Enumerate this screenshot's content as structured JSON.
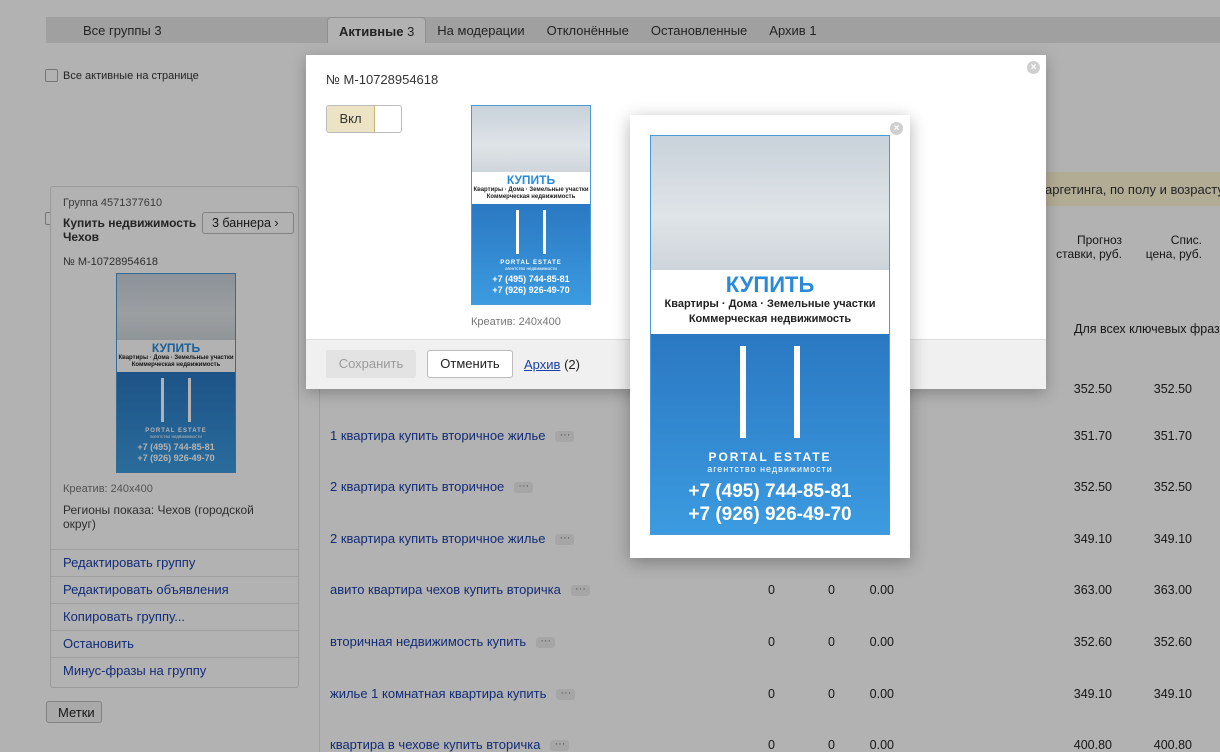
{
  "topbar": {
    "all_groups": "Все группы 3"
  },
  "tabs": [
    {
      "label": "Активные",
      "count": "3"
    },
    {
      "label": "На модерации"
    },
    {
      "label": "Отклонённые"
    },
    {
      "label": "Остановленные"
    },
    {
      "label": "Архив",
      "count": "1"
    }
  ],
  "select_all_label": "Все активные на странице",
  "group": {
    "id_label": "Группа 4571377610",
    "name": "Купить недвижимость Чехов",
    "banners_button": "3 баннера",
    "banner_id": "№ М-10728954618",
    "creative_size": "Креатив: 240x400",
    "regions": "Регионы показа: Чехов (городской округ)",
    "menu": [
      "Редактировать группу",
      "Редактировать объявления",
      "Копировать группу...",
      "Остановить",
      "Минус-фразы на группу"
    ]
  },
  "labels_button": "Метки",
  "banner_ad": {
    "headline": "КУПИТЬ",
    "line1": "Квартиры · Дома · Земельные участки",
    "line2": "Коммерческая недвижимость",
    "brand": "PORTAL ESTATE",
    "brand_sub": "агентство недвижимости",
    "phone1": "+7 (495) 744-85-81",
    "phone2": "+7 (926) 926-49-70"
  },
  "modal": {
    "title": "№ М-10728954618",
    "toggle_label": "Вкл",
    "creative_size": "Креатив: 240x400",
    "save": "Сохранить",
    "cancel": "Отменить",
    "archive_link": "Архив",
    "archive_count": "(2)"
  },
  "notice_text": "аргетинга, по полу и возрасту",
  "table": {
    "col_forecast": "Прогноз ставки, руб.",
    "col_price": "Спис. цена, руб.",
    "all_phrases": "Для всех ключевых фраз:",
    "rows": [
      {
        "phrase": "",
        "forecast": "352.50",
        "price": "352.50"
      },
      {
        "phrase": "1 квартира купить вторичное жилье",
        "forecast": "351.70",
        "price": "351.70"
      },
      {
        "phrase": "2 квартира купить вторичное",
        "forecast": "352.50",
        "price": "352.50"
      },
      {
        "phrase": "2 квартира купить вторичное жилье",
        "forecast": "349.10",
        "price": "349.10"
      },
      {
        "phrase": "авито квартира чехов купить вторичка",
        "c1": "0",
        "c2": "0",
        "c3": "0.00",
        "forecast": "363.00",
        "price": "363.00"
      },
      {
        "phrase": "вторичная недвижимость купить",
        "c1": "0",
        "c2": "0",
        "c3": "0.00",
        "forecast": "352.60",
        "price": "352.60"
      },
      {
        "phrase": "жилье 1 комнатная квартира купить",
        "c1": "0",
        "c2": "0",
        "c3": "0.00",
        "forecast": "349.10",
        "price": "349.10"
      },
      {
        "phrase": "квартира в чехове купить вторичка",
        "c1": "0",
        "c2": "0",
        "c3": "0.00",
        "forecast": "400.80",
        "price": "400.80"
      }
    ]
  }
}
